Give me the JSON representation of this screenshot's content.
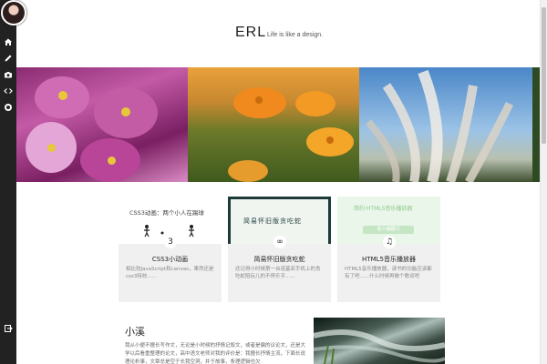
{
  "header": {
    "logo": "ERL",
    "tagline": "Life is like a design."
  },
  "sidebar": {
    "icons": [
      "home-icon",
      "pencil-icon",
      "camera-icon",
      "code-icon",
      "github-icon"
    ],
    "bottom_icon": "sign-out-icon"
  },
  "projects": [
    {
      "thumb_text": "CSS3动画：两个小人在踢球",
      "icon": "css3-icon",
      "icon_glyph": "3",
      "title": "CSS3小动画",
      "desc": "相比较JavaScript和canvas，果然还是css3特效......"
    },
    {
      "thumb_text": "简易怀旧版贪吃蛇",
      "icon": "gamepad-icon",
      "icon_glyph": "∞",
      "title": "简易怀旧版贪吃蛇",
      "desc": "还记得小时候第一台诺基亚手机上的贪吃蛇陪玩儿的不停乐乎......"
    },
    {
      "thumb_text": "简约·HTML5音乐播放器",
      "thumb_button": "看小编翻讨",
      "icon": "music-icon",
      "icon_glyph": "♫",
      "title": "HTML5音乐播放器",
      "desc": "HTML5音乐播放器，读书的功能应该都有了吧......什么时候再做个歌词吧"
    }
  ],
  "article": {
    "title": "小溪",
    "text": "我从小便不擅长写作文，无论是小时候的抒情记叙文，或者是偏的议论文，还是大学以后看重整理的论文，高中语文老师对我的评价是：我擅长抒情主流，下面长说理论析事，文章总是空于长我空洞，并于故事，条理逻辑也欠"
  },
  "colors": {
    "sidebar": "#222222",
    "card_body": "#f0f0f0",
    "snake_frame": "#1d3a3a",
    "player_thumb": "#e9f6e9"
  }
}
